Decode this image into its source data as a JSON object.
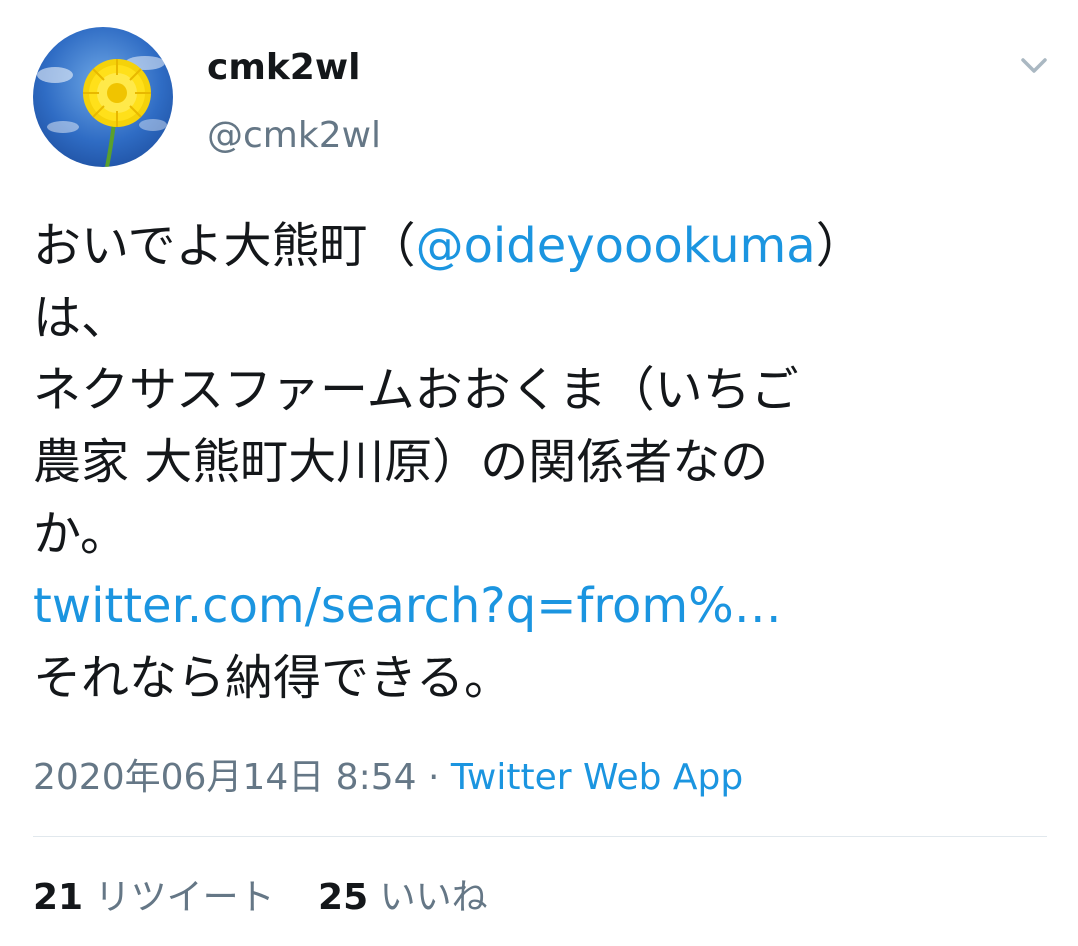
{
  "user": {
    "display_name": "cmk2wl",
    "handle": "@cmk2wl",
    "avatar_icon": "dandelion-avatar-icon"
  },
  "menu": {
    "icon": "chevron-down-icon"
  },
  "tweet": {
    "line1_prefix": "おいでよ大熊町（",
    "mention": "@oideyoookuma",
    "line1_suffix": "）",
    "line2": "は、",
    "line3": "ネクサスファームおおくま（いちご",
    "line4": "農家 大熊町大川原）の関係者なの",
    "line5": "か。",
    "link": "twitter.com/search?q=from%…",
    "line7": "それなら納得できる。"
  },
  "meta": {
    "timestamp": "2020年06月14日 8:54",
    "separator": " · ",
    "source": "Twitter Web App"
  },
  "stats": {
    "retweet_count": "21",
    "retweet_label": "リツイート",
    "like_count": "25",
    "like_label": "いいね"
  },
  "colors": {
    "link": "#1b95e0",
    "secondary_text": "#657786",
    "primary_text": "#14171a",
    "divider": "#e1e8ed"
  }
}
